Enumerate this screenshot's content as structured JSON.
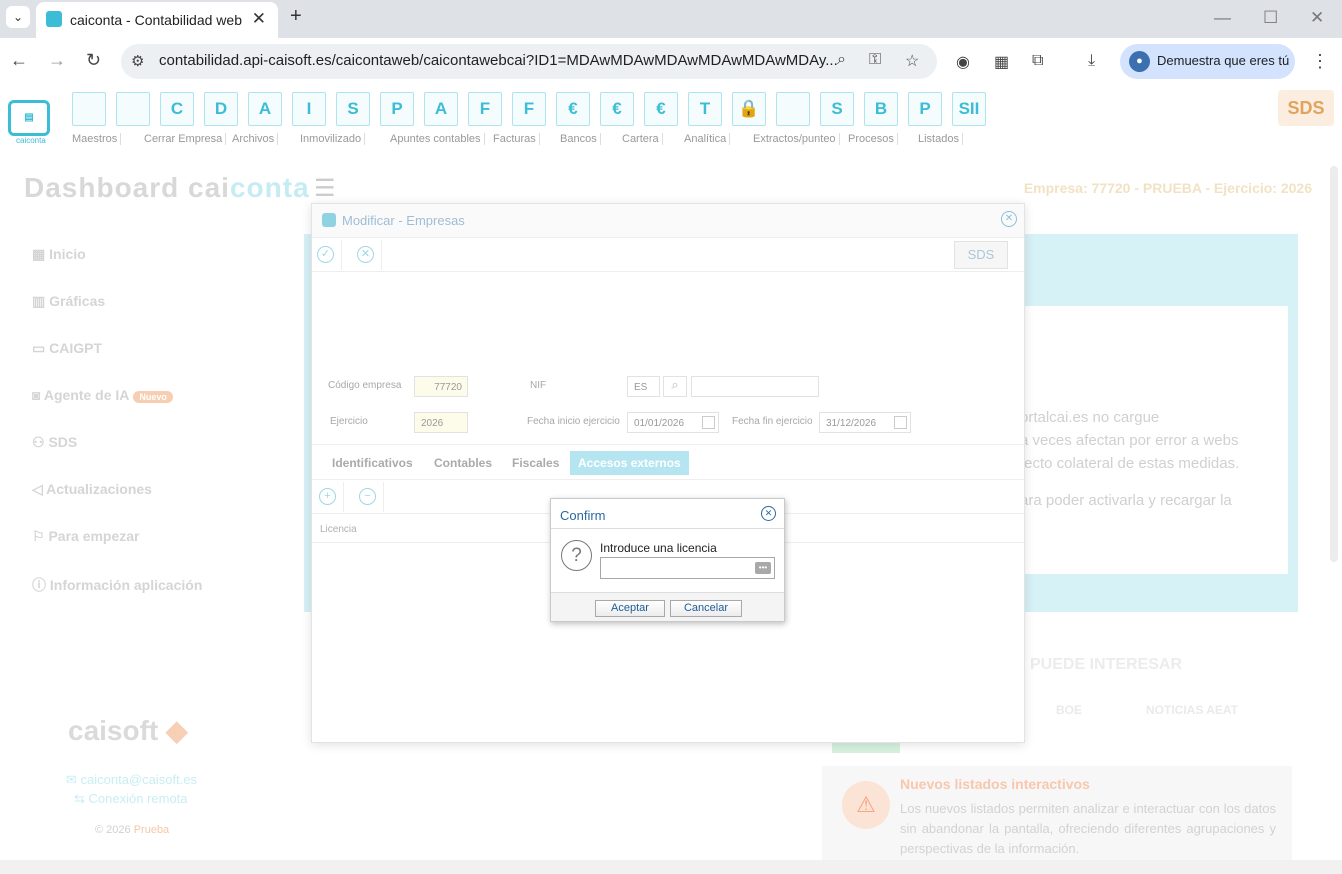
{
  "browser": {
    "tab_title": "caiconta - Contabilidad web",
    "url": "contabilidad.api-caisoft.es/caicontaweb/caicontawebcai?ID1=MDAwMDAwMDAwMDAwMDAwMDAy...",
    "profile_label": "Demuestra que eres tú"
  },
  "toolbar": {
    "icons": [
      {
        "name": "folder-icon",
        "label": ""
      },
      {
        "name": "calendar-icon",
        "label": ""
      },
      {
        "name": "ctas-icon",
        "label": "C"
      },
      {
        "name": "deud-icon",
        "label": "D"
      },
      {
        "name": "acre-icon",
        "label": "A"
      },
      {
        "name": "inmv-icon",
        "label": "I"
      },
      {
        "name": "subv-icon",
        "label": "S"
      },
      {
        "name": "pred-icon",
        "label": "P"
      },
      {
        "name": "acon-icon",
        "label": "A"
      },
      {
        "name": "fexp-icon",
        "label": "F"
      },
      {
        "name": "frec-icon",
        "label": "F"
      },
      {
        "name": "money-bag-icon",
        "label": "€"
      },
      {
        "name": "euro-c-icon",
        "label": "€"
      },
      {
        "name": "euro-p-icon",
        "label": "€"
      },
      {
        "name": "dh-icon",
        "label": "T"
      },
      {
        "name": "lock-icon",
        "label": "🔒"
      },
      {
        "name": "document-icon",
        "label": ""
      },
      {
        "name": "ss-icon",
        "label": "S"
      },
      {
        "name": "bsit-icon",
        "label": "B"
      },
      {
        "name": "pg-icon",
        "label": "P"
      },
      {
        "name": "sii-icon",
        "label": "SII"
      }
    ]
  },
  "menubar": [
    "Maestros",
    "Cerrar Empresa",
    "Archivos",
    "Inmovilizado",
    "Apuntes contables",
    "Facturas",
    "Bancos",
    "Cartera",
    "Analítica",
    "Extractos/punteo",
    "Procesos",
    "Listados"
  ],
  "header": {
    "dash_a": "Dashboard",
    "dash_b": "cai",
    "dash_c": "conta",
    "empresa": "Empresa: 77720 - PRUEBA - Ejercicio: 2026"
  },
  "sidebar": {
    "items": [
      {
        "label": "Inicio"
      },
      {
        "label": "Gráficas"
      },
      {
        "label": "CAIGPT"
      },
      {
        "label": "Agente de IA",
        "badge": "Nuevo"
      },
      {
        "label": "SDS"
      },
      {
        "label": "Actualizaciones"
      },
      {
        "label": "Para empezar"
      },
      {
        "label": "Información aplicación"
      }
    ],
    "brand": "caisoft",
    "email": "caiconta@caisoft.es",
    "remote": "Conexión remota",
    "copyright": "© 2026",
    "copyright_brand": "Prueba"
  },
  "background": {
    "text_lines": [
      "ortalcai.es no cargue",
      "a veces afectan por error a webs",
      "fecto colateral de estas medidas.",
      "ara poder activarla y recargar la"
    ],
    "interesar": "PUEDE INTERESAR",
    "boe": "BOE",
    "noticias": "NOTICIAS AEAT",
    "news_title": "Nuevos listados interactivos",
    "news_body": "Los nuevos listados permiten analizar e interactuar con los datos sin abandonar la pantalla, ofreciendo diferentes agrupaciones y perspectivas de la información."
  },
  "modal": {
    "title": "Modificar - Empresas",
    "sds_label": "SDS",
    "codigo_label": "Código empresa",
    "codigo_value": "77720",
    "nif_label": "NIF",
    "nif_country": "ES",
    "nif_value": "",
    "ejercicio_label": "Ejercicio",
    "ejercicio_value": "2026",
    "fecha_inicio_label": "Fecha inicio ejercicio",
    "fecha_inicio_value": "01/01/2026",
    "fecha_fin_label": "Fecha fin ejercicio",
    "fecha_fin_value": "31/12/2026",
    "tabs": [
      {
        "label": "Identificativos"
      },
      {
        "label": "Contables"
      },
      {
        "label": "Fiscales"
      },
      {
        "label": "Accesos externos"
      }
    ],
    "column_licencia": "Licencia"
  },
  "confirm": {
    "title": "Confirm",
    "message": "Introduce una licencia",
    "input_value": "",
    "accept": "Aceptar",
    "cancel": "Cancelar"
  }
}
